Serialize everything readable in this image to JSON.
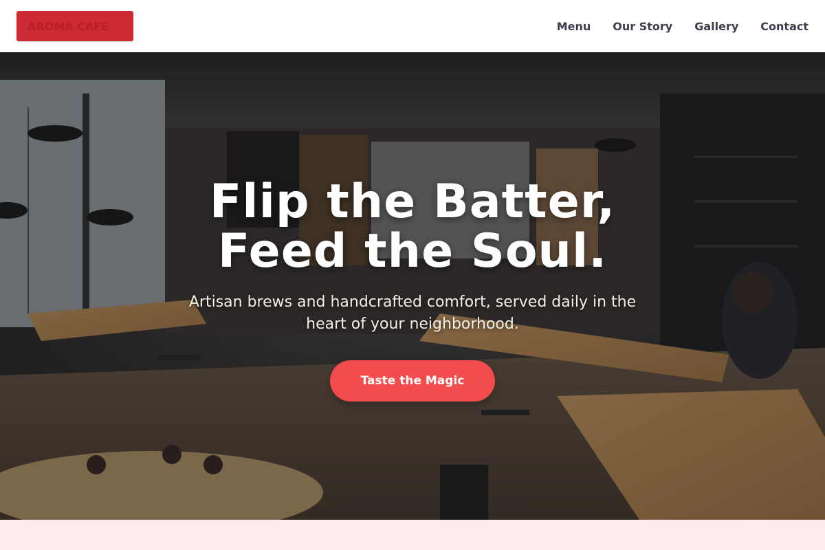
{
  "header": {
    "logo_text": "AROMA CAFE",
    "nav": [
      {
        "label": "Menu"
      },
      {
        "label": "Our Story"
      },
      {
        "label": "Gallery"
      },
      {
        "label": "Contact"
      }
    ]
  },
  "hero": {
    "title": "Flip the Batter,\nFeed the Soul.",
    "subtitle": "Artisan brews and handcrafted comfort, served daily in the heart of your neighborhood.",
    "cta_label": "Taste the Magic"
  },
  "colors": {
    "brand": "#cc2b33",
    "accent": "#f24c4c",
    "nav_text": "#3a3f4b",
    "footer_band": "#fdeced"
  }
}
